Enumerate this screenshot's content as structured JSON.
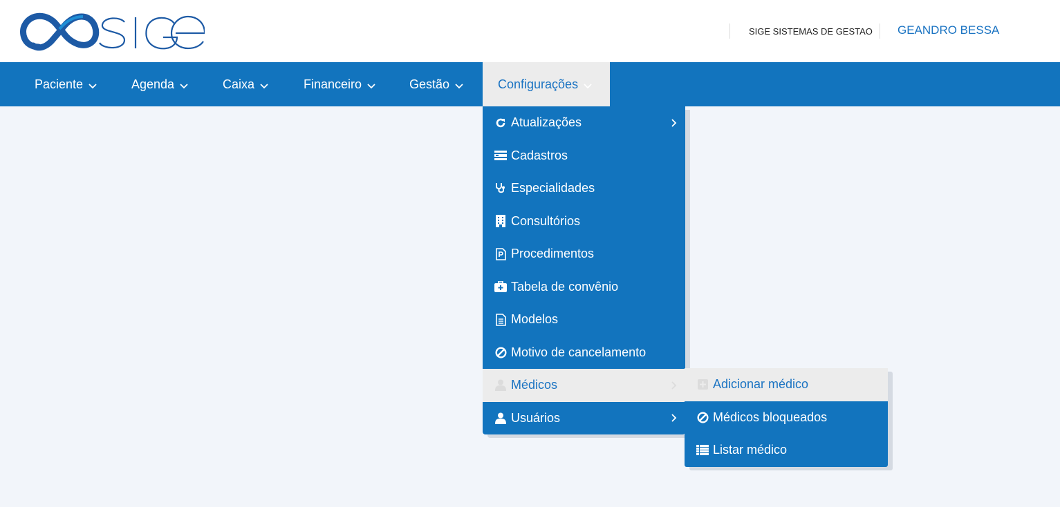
{
  "header": {
    "logo_text": "SIGE",
    "company": "SIGE SISTEMAS DE GESTAO",
    "user": "GEANDRO BESSA"
  },
  "nav": [
    {
      "label": "Paciente",
      "icon": "chevron-down-icon"
    },
    {
      "label": "Agenda",
      "icon": "chevron-down-icon"
    },
    {
      "label": "Caixa",
      "icon": "chevron-down-icon"
    },
    {
      "label": "Financeiro",
      "icon": "chevron-down-icon"
    },
    {
      "label": "Gestão",
      "icon": "chevron-down-icon"
    },
    {
      "label": "Configurações",
      "icon": "chevron-down-icon",
      "active": true
    }
  ],
  "config_menu": [
    {
      "label": "Atualizações",
      "icon": "refresh-icon",
      "submenu": true
    },
    {
      "label": "Cadastros",
      "icon": "list-card-icon"
    },
    {
      "label": "Especialidades",
      "icon": "stethoscope-icon"
    },
    {
      "label": "Consultórios",
      "icon": "building-icon"
    },
    {
      "label": "Procedimentos",
      "icon": "file-p-icon"
    },
    {
      "label": "Tabela de convênio",
      "icon": "medkit-icon"
    },
    {
      "label": "Modelos",
      "icon": "document-icon"
    },
    {
      "label": "Motivo de cancelamento",
      "icon": "ban-icon"
    },
    {
      "label": "Médicos",
      "icon": "user-md-icon",
      "submenu": true,
      "highlighted": true
    },
    {
      "label": "Usuários",
      "icon": "user-icon",
      "submenu": true
    }
  ],
  "medicos_submenu": [
    {
      "label": "Adicionar médico",
      "icon": "plus-square-icon",
      "highlighted": true
    },
    {
      "label": "Médicos bloqueados",
      "icon": "ban-icon"
    },
    {
      "label": "Listar médico",
      "icon": "list-icon"
    }
  ],
  "colors": {
    "primary": "#1274be",
    "highlight_bg": "#ececec",
    "highlight_text": "#1a73c2",
    "page_bg": "#f2f5fa"
  }
}
